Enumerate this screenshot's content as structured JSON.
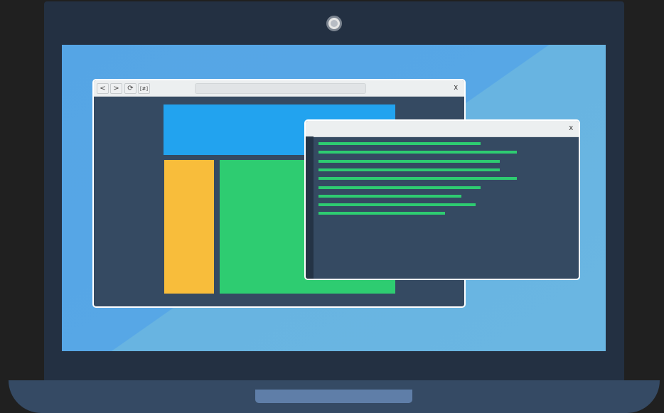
{
  "colors": {
    "background": "#202020",
    "bezel": "#233042",
    "screen": "#57a7e6",
    "window_body": "#354a62",
    "titlebar": "#eceff0",
    "header_block": "#22a3ef",
    "sidebar_block": "#f8bd3b",
    "content_block": "#2ecc71",
    "code_line": "#2ecc71",
    "base": "#354a64"
  },
  "browser": {
    "back_icon": "chevron-left-icon",
    "back_label": "<",
    "forward_icon": "chevron-right-icon",
    "forward_label": ">",
    "reload_icon": "reload-icon",
    "reload_label": "⟳",
    "bookmarks_icon": "bookmarks-icon",
    "bookmarks_label": "[#]",
    "address_value": "",
    "close_label": "x"
  },
  "editor": {
    "close_label": "x",
    "code_line_widths": [
      0.59,
      0.72,
      0.66,
      0.66,
      0.72,
      0.59,
      0.52,
      0.57,
      0.46
    ]
  }
}
